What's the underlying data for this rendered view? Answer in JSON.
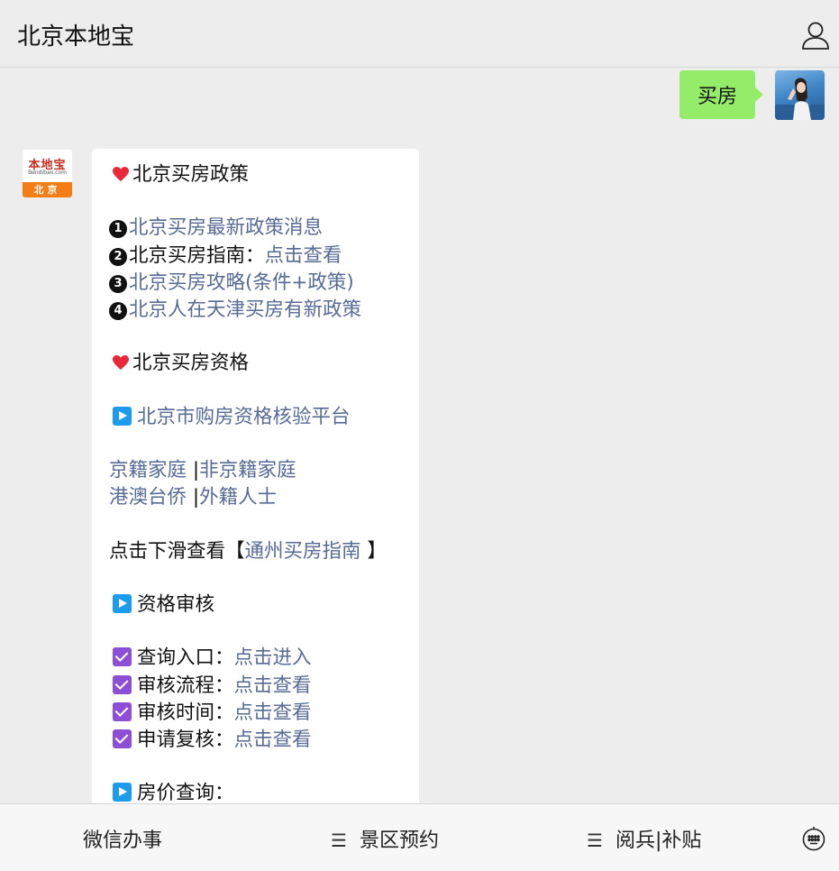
{
  "header": {
    "title": "北京本地宝",
    "user_icon": "user-icon"
  },
  "user_message": {
    "text": "买房"
  },
  "bot": {
    "avatar_logo": "本地宝",
    "avatar_sub": "Bendibao.com",
    "avatar_label": "北京",
    "section1_title": "北京买房政策",
    "items": [
      {
        "num": "1",
        "prefix": "",
        "link": "北京买房最新政策消息"
      },
      {
        "num": "2",
        "prefix": "北京买房指南：",
        "link": "点击查看"
      },
      {
        "num": "3",
        "prefix": "",
        "link": "北京买房攻略(条件+政策)"
      },
      {
        "num": "4",
        "prefix": "",
        "link": "北京人在天津买房有新政策"
      }
    ],
    "section2_title": "北京买房资格",
    "platform_link": "北京市购房资格核验平台",
    "family": {
      "beijing": "京籍家庭",
      "non_beijing": "非京籍家庭",
      "hk_macao_tw": "港澳台侨",
      "foreign": "外籍人士",
      "sep": "|"
    },
    "tongzhou": {
      "prefix": "点击下滑查看【",
      "link": "通州买房指南",
      "suffix": " 】"
    },
    "audit_title": "资格审核",
    "audit_items": [
      {
        "label": "查询入口：",
        "link": "点击进入"
      },
      {
        "label": "审核流程：",
        "link": "点击查看"
      },
      {
        "label": "审核时间：",
        "link": "点击查看"
      },
      {
        "label": "申请复核：",
        "link": "点击查看"
      }
    ],
    "price_title": "房价查询："
  },
  "menu": {
    "items": [
      "微信办事",
      "景区预约",
      "阅兵|补贴"
    ],
    "hamburger": "☰"
  },
  "colors": {
    "link": "#576b95",
    "bubble_out": "#95ec69",
    "play": "#1d9bec",
    "check": "#8c4fd6"
  }
}
